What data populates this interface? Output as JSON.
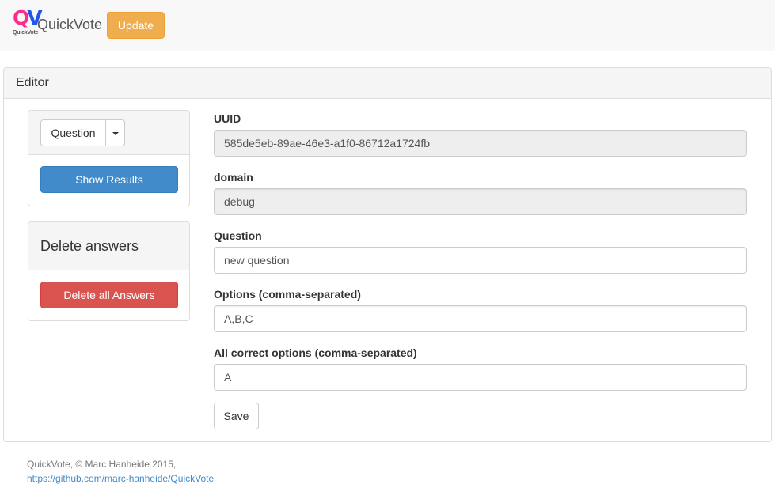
{
  "navbar": {
    "logo_letters": "QV",
    "logo_caption": "QuickVote",
    "brand": "QuickVote",
    "update_label": "Update"
  },
  "panel": {
    "heading": "Editor"
  },
  "sidebar": {
    "dropdown_label": "Question",
    "show_results_label": "Show Results",
    "delete_heading": "Delete answers",
    "delete_all_label": "Delete all Answers"
  },
  "form": {
    "uuid_label": "UUID",
    "uuid_value": "585de5eb-89ae-46e3-a1f0-86712a1724fb",
    "domain_label": "domain",
    "domain_value": "debug",
    "question_label": "Question",
    "question_value": "new question",
    "options_label": "Options (comma-separated)",
    "options_value": "A,B,C",
    "correct_label": "All correct options (comma-separated)",
    "correct_value": "A",
    "save_label": "Save"
  },
  "footer": {
    "credit": "QuickVote, © Marc Hanheide 2015,",
    "link": "https://github.com/marc-hanheide/QuickVote"
  },
  "colors": {
    "update": "#f0ad4e",
    "primary": "#428bca",
    "danger": "#d9534f",
    "logo_q": "#ff2a8a",
    "logo_v": "#2255ee"
  }
}
